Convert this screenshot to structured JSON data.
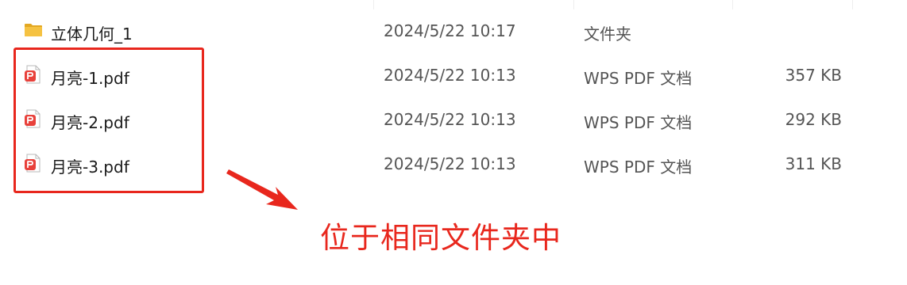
{
  "files": [
    {
      "name": "立体几何_1",
      "date": "2024/5/22 10:17",
      "type": "文件夹",
      "size": "",
      "icon": "folder-icon"
    },
    {
      "name": "月亮-1.pdf",
      "date": "2024/5/22 10:13",
      "type": "WPS PDF 文档",
      "size": "357 KB",
      "icon": "pdf-icon"
    },
    {
      "name": "月亮-2.pdf",
      "date": "2024/5/22 10:13",
      "type": "WPS PDF 文档",
      "size": "292 KB",
      "icon": "pdf-icon"
    },
    {
      "name": "月亮-3.pdf",
      "date": "2024/5/22 10:13",
      "type": "WPS PDF 文档",
      "size": "311 KB",
      "icon": "pdf-icon"
    }
  ],
  "annotation": {
    "text": "位于相同文件夹中",
    "color": "#e8271d"
  },
  "colors": {
    "folder": "#f5c242",
    "pdf": "#e8413b",
    "text_primary": "#1a1a1a",
    "text_secondary": "#555555"
  }
}
